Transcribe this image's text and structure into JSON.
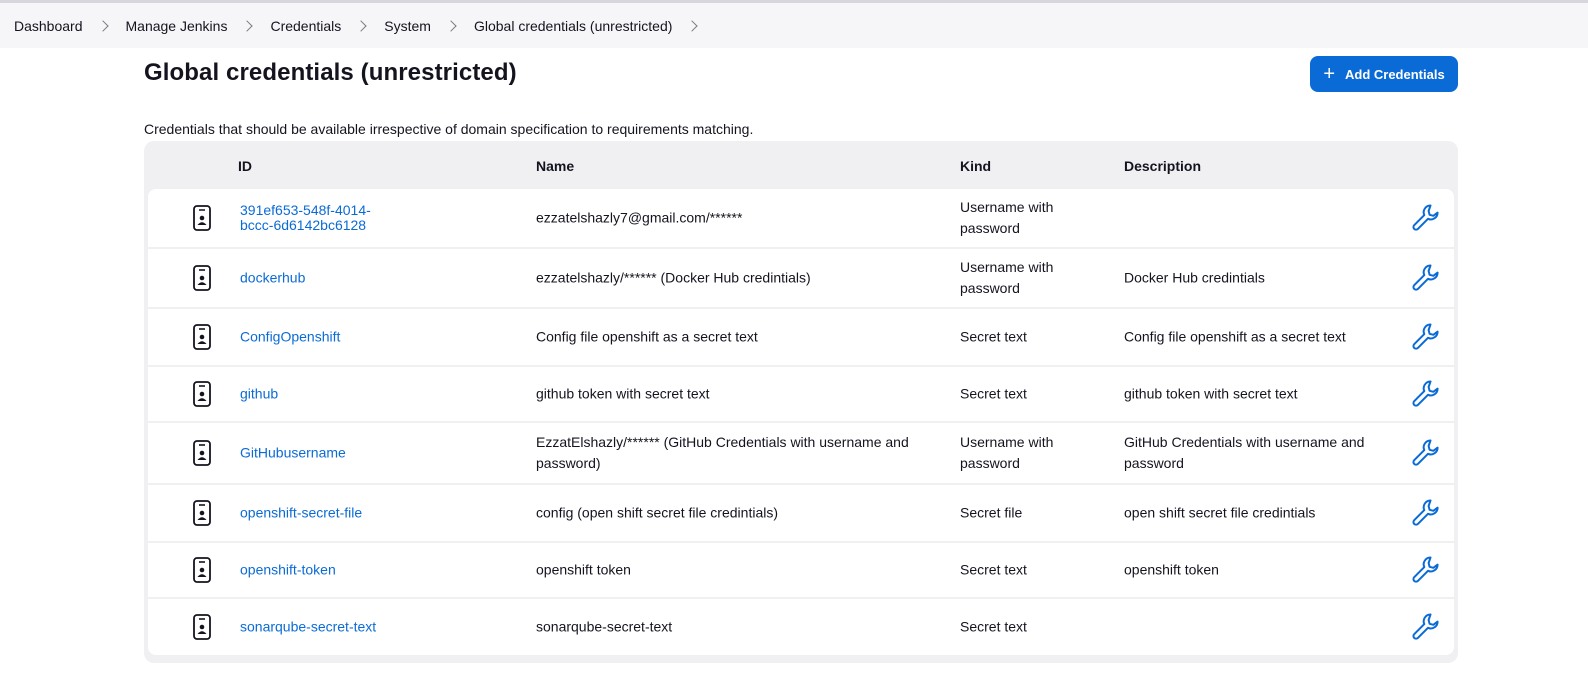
{
  "breadcrumbs": [
    "Dashboard",
    "Manage Jenkins",
    "Credentials",
    "System",
    "Global credentials (unrestricted)"
  ],
  "page": {
    "title": "Global credentials (unrestricted)",
    "add_button": "Add Credentials",
    "description": "Credentials that should be available irrespective of domain specification to requirements matching."
  },
  "table": {
    "headers": {
      "id": "ID",
      "name": "Name",
      "kind": "Kind",
      "description": "Description"
    },
    "rows": [
      {
        "id": "391ef653-548f-4014-\nbccc-6d6142bc6128",
        "name": "ezzatelshazly7@gmail.com/******",
        "kind": "Username with password",
        "description": ""
      },
      {
        "id": "dockerhub",
        "name": "ezzatelshazly/****** (Docker Hub credintials)",
        "kind": "Username with password",
        "description": "Docker Hub credintials"
      },
      {
        "id": "ConfigOpenshift",
        "name": "Config file openshift as a secret text",
        "kind": "Secret text",
        "description": "Config file openshift as a secret text"
      },
      {
        "id": "github",
        "name": "github token with secret text",
        "kind": "Secret text",
        "description": "github token with secret text"
      },
      {
        "id": "GitHubusername",
        "name": "EzzatElshazly/****** (GitHub Credentials with username and password)",
        "kind": "Username with password",
        "description": "GitHub Credentials with username and password"
      },
      {
        "id": "openshift-secret-file",
        "name": "config (open shift secret file credintials)",
        "kind": "Secret file",
        "description": "open shift secret file credintials"
      },
      {
        "id": "openshift-token",
        "name": "openshift token",
        "kind": "Secret text",
        "description": "openshift token"
      },
      {
        "id": "sonarqube-secret-text",
        "name": "sonarqube-secret-text",
        "kind": "Secret text",
        "description": ""
      }
    ]
  },
  "icons": {
    "row_icon": "credential-card-icon",
    "action_icon": "wrench-icon",
    "add_icon": "plus-icon"
  },
  "colors": {
    "accent": "#0b6bd6",
    "table_bg": "#f0f0f3",
    "breadcrumb_bg": "#f6f6f8"
  }
}
